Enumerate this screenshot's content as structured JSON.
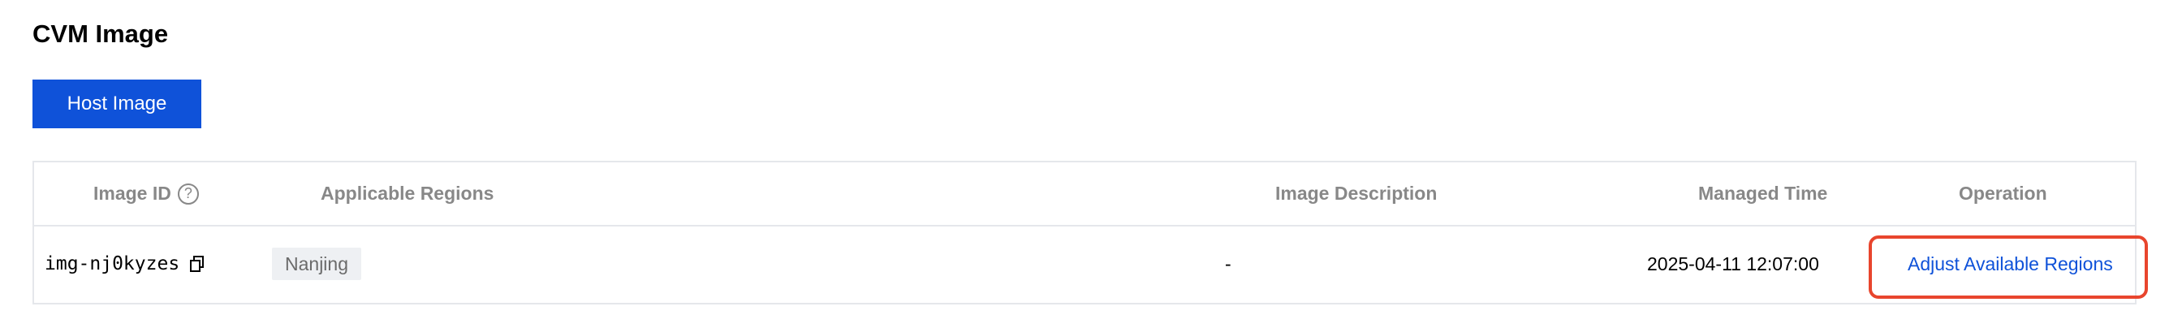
{
  "page": {
    "title": "CVM Image"
  },
  "toolbar": {
    "host_image_label": "Host Image"
  },
  "table": {
    "columns": {
      "image_id": "Image ID",
      "applicable_regions": "Applicable Regions",
      "image_description": "Image Description",
      "managed_time": "Managed Time",
      "operation": "Operation"
    },
    "help_icon_glyph": "?",
    "rows": [
      {
        "image_id": "img-nj0kyzes",
        "region": "Nanjing",
        "description": "-",
        "managed_time": "2025-04-11 12:07:00",
        "operation_label": "Adjust Available Regions"
      }
    ]
  },
  "icons": {
    "help": "question-circle-icon",
    "copy": "copy-icon"
  },
  "colors": {
    "primary": "#0f52d9",
    "link": "#0f52d9",
    "highlight": "#e8452d",
    "header_text": "#888888",
    "border": "#e5e7eb",
    "tag_bg": "#eef0f3"
  }
}
